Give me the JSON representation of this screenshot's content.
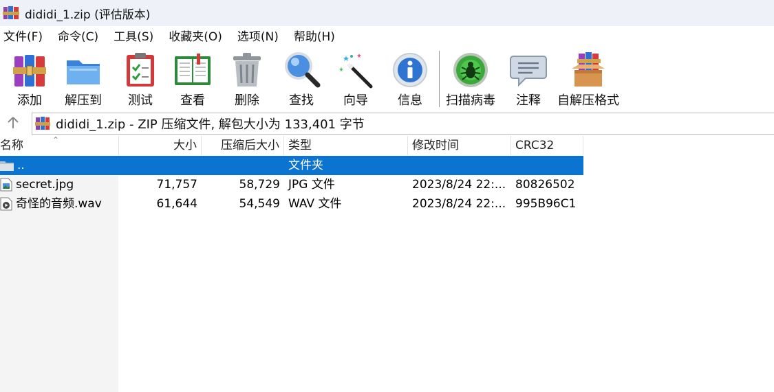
{
  "window": {
    "title": "dididi_1.zip (评估版本)"
  },
  "menu": [
    "文件(F)",
    "命令(C)",
    "工具(S)",
    "收藏夹(O)",
    "选项(N)",
    "帮助(H)"
  ],
  "toolbar": [
    {
      "label": "添加",
      "icon": "archive-books-icon"
    },
    {
      "label": "解压到",
      "icon": "folder-icon"
    },
    {
      "label": "测试",
      "icon": "clipboard-check-icon"
    },
    {
      "label": "查看",
      "icon": "open-book-icon"
    },
    {
      "label": "删除",
      "icon": "trash-can-icon"
    },
    {
      "label": "查找",
      "icon": "magnifier-icon"
    },
    {
      "label": "向导",
      "icon": "magic-wand-icon"
    },
    {
      "label": "信息",
      "icon": "info-icon"
    },
    {
      "label": "扫描病毒",
      "icon": "bug-scan-icon"
    },
    {
      "label": "注释",
      "icon": "speech-bubble-icon"
    },
    {
      "label": "自解压格式",
      "icon": "box-books-icon"
    }
  ],
  "address": {
    "text": "dididi_1.zip - ZIP 压缩文件, 解包大小为 133,401 字节"
  },
  "columns": {
    "name": "名称",
    "size": "大小",
    "packed": "压缩后大小",
    "type": "类型",
    "mtime": "修改时间",
    "crc": "CRC32"
  },
  "rows": [
    {
      "name": "..",
      "size": "",
      "packed": "",
      "type": "文件夹",
      "mtime": "",
      "crc": "",
      "icon": "folder-icon",
      "selected": true
    },
    {
      "name": "secret.jpg",
      "size": "71,757",
      "packed": "58,729",
      "type": "JPG 文件",
      "mtime": "2023/8/24 22:...",
      "crc": "80826502",
      "icon": "image-file-icon",
      "selected": false
    },
    {
      "name": "奇怪的音频.wav",
      "size": "61,644",
      "packed": "54,549",
      "type": "WAV 文件",
      "mtime": "2023/8/24 22:...",
      "crc": "995B96C1",
      "icon": "audio-file-icon",
      "selected": false
    }
  ]
}
